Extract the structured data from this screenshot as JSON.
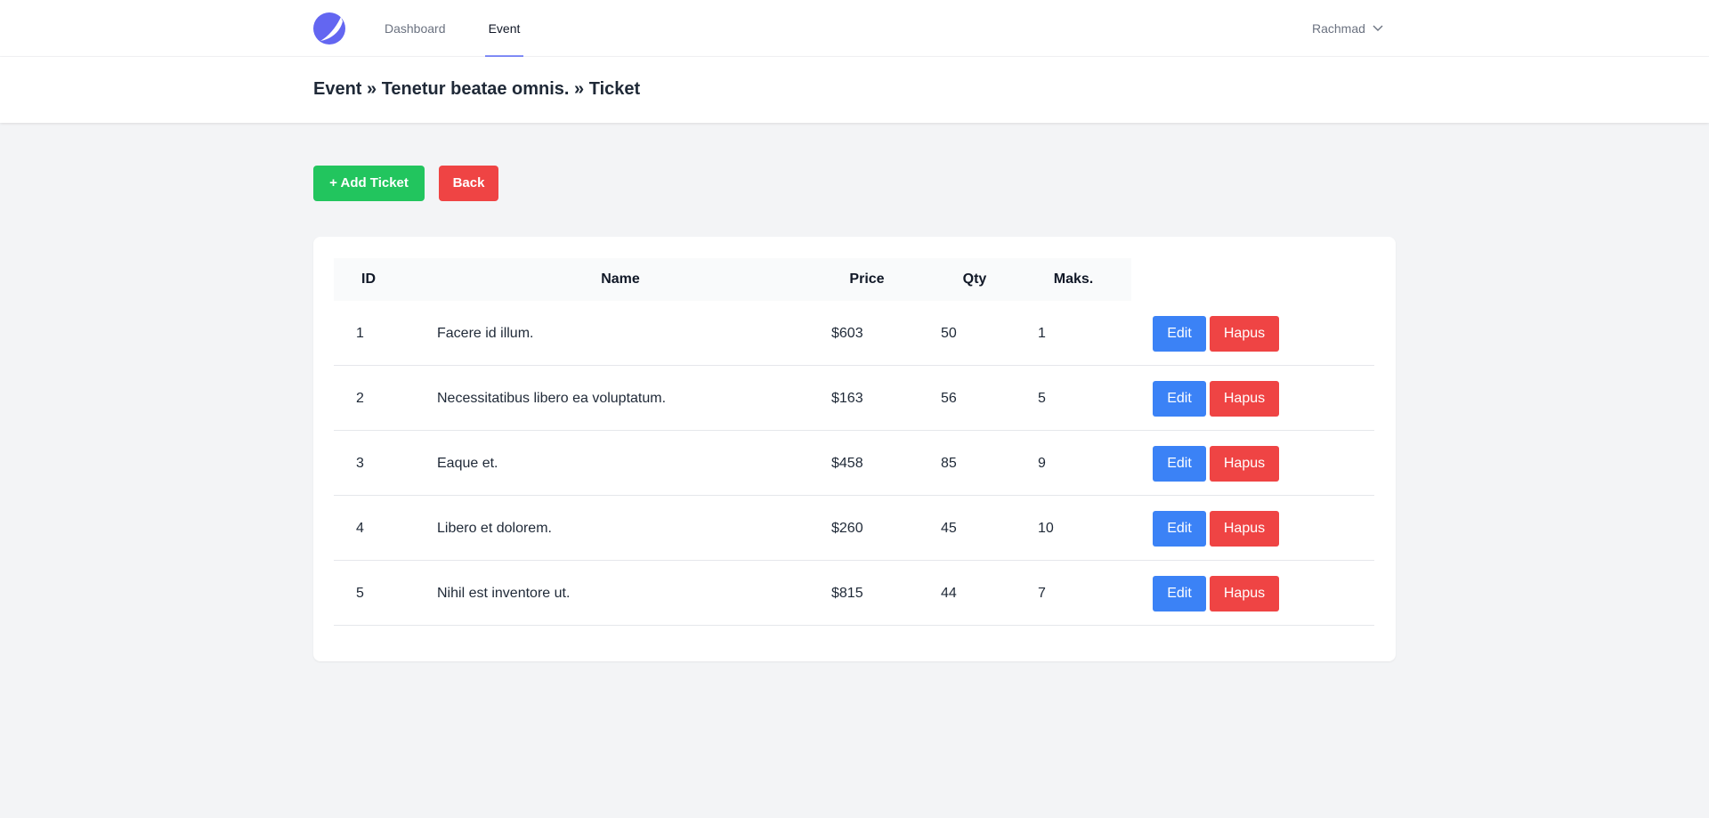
{
  "nav": {
    "links": [
      "Dashboard",
      "Event"
    ],
    "active": "Event",
    "user_name": "Rachmad"
  },
  "header": {
    "title": "Event » Tenetur beatae omnis. » Ticket"
  },
  "actions": {
    "add_label": "+ Add Ticket",
    "back_label": "Back"
  },
  "table": {
    "columns": [
      "ID",
      "Name",
      "Price",
      "Qty",
      "Maks."
    ],
    "rows": [
      {
        "id": "1",
        "name": "Facere id illum.",
        "price": "$603",
        "qty": "50",
        "maks": "1"
      },
      {
        "id": "2",
        "name": "Necessitatibus libero ea voluptatum.",
        "price": "$163",
        "qty": "56",
        "maks": "5"
      },
      {
        "id": "3",
        "name": "Eaque et.",
        "price": "$458",
        "qty": "85",
        "maks": "9"
      },
      {
        "id": "4",
        "name": "Libero et dolorem.",
        "price": "$260",
        "qty": "45",
        "maks": "10"
      },
      {
        "id": "5",
        "name": "Nihil est inventore ut.",
        "price": "$815",
        "qty": "44",
        "maks": "7"
      }
    ],
    "edit_label": "Edit",
    "delete_label": "Hapus"
  },
  "colors": {
    "accent": "#6366f1",
    "success": "#22c55e",
    "danger": "#ef4444",
    "primary": "#3b82f6",
    "background": "#f3f4f6"
  },
  "icons": {
    "logo": "app-logo-icon",
    "user_menu": "chevron-down-icon"
  }
}
